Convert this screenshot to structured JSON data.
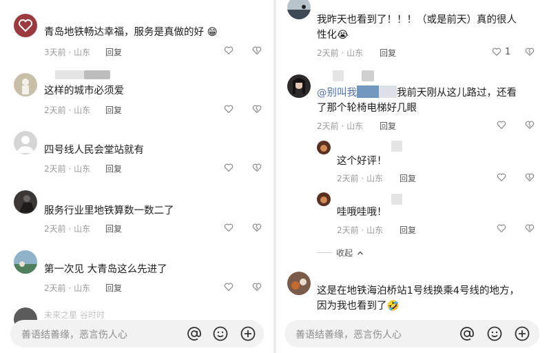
{
  "input_placeholder": "善语结善缘，恶言伤人心",
  "reply_label": "回复",
  "collapse_label": "收起",
  "left_comments": [
    {
      "text": "青岛地铁畅达幸福，服务是真做的好",
      "time": "3天前",
      "location": "山东",
      "emoji": "grin"
    },
    {
      "text": "这样的城市必须爱",
      "time": "2天前",
      "location": "山东"
    },
    {
      "text": "四号线人民会堂站就有",
      "time": "2天前",
      "location": "山东"
    },
    {
      "text": "服务行业里地铁算数一数二了",
      "time": "2天前",
      "location": "山东"
    },
    {
      "text": "第一次见 大青岛这么先进了",
      "time": "2天前",
      "location": "山东"
    }
  ],
  "left_partial_name": "未来之星 谷时时",
  "right_comments": [
    {
      "text_line1": "我昨天也看到了！！！（或是前天）真的很人",
      "text_line2": "性化",
      "time": "2天前",
      "location": "山东",
      "likes": "1",
      "emoji": "tear"
    },
    {
      "mention": "@别叫我",
      "text_line1": "我前天刚从这儿路过，还看",
      "text_line2": "了那个轮椅电梯好几眼",
      "time": "2天前",
      "location": "山东"
    },
    {
      "text": "这个好评！",
      "time": "2天前",
      "location": "山东"
    },
    {
      "text": "哇哦哇哦！",
      "time": "2天前",
      "location": "山东"
    },
    {
      "text_line1": "这是在地铁海泊桥站1号线换乘4号线的地方，",
      "text_line2": "因为我也看到了",
      "emoji": "laugh"
    }
  ],
  "colors": {
    "text": "#1c1c1c",
    "meta": "#9a9a9a",
    "mention": "#4a6fa5",
    "input_bg": "#f2f2f2"
  },
  "icons": [
    "heart-icon",
    "dislike-heart-icon",
    "at-icon",
    "emoji-face-icon",
    "plus-circle-icon",
    "chevron-up-icon"
  ]
}
